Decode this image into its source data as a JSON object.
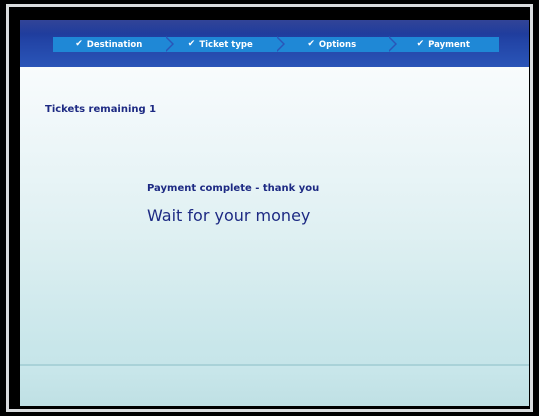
{
  "progress": {
    "steps": [
      {
        "label": "Destination",
        "status": "complete"
      },
      {
        "label": "Ticket type",
        "status": "complete"
      },
      {
        "label": "Options",
        "status": "complete"
      },
      {
        "label": "Payment",
        "status": "complete"
      }
    ],
    "check_icon": "checkmark-icon"
  },
  "status": {
    "tickets_remaining": "Tickets remaining 1"
  },
  "message": {
    "subtitle": "Payment complete - thank you",
    "title": "Wait for your money"
  },
  "colors": {
    "header_blue": "#2244a6",
    "step_blue": "#1f88d6",
    "text_navy": "#1d2a83",
    "background_light": "#f1f8fa",
    "background_teal": "#c8e6ea"
  }
}
